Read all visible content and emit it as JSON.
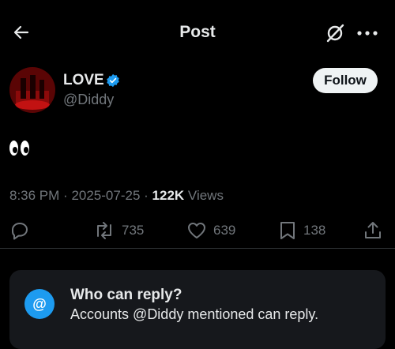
{
  "header": {
    "title": "Post",
    "icons": {
      "back": "arrow-left-icon",
      "grok": "grok-icon",
      "more": "more-dots-icon"
    }
  },
  "author": {
    "name": "LOVE",
    "handle": "@Diddy",
    "verified": true,
    "follow_label": "Follow"
  },
  "post": {
    "text_emoji": "👀",
    "time": "8:36 PM",
    "date": "2025-07-25",
    "views_count": "122K",
    "views_label": "Views"
  },
  "actions": {
    "reply": {
      "icon": "reply-icon",
      "count": ""
    },
    "repost": {
      "icon": "repost-icon",
      "count": "735"
    },
    "like": {
      "icon": "heart-icon",
      "count": "639"
    },
    "bookmark": {
      "icon": "bookmark-icon",
      "count": "138"
    },
    "share": {
      "icon": "share-icon"
    }
  },
  "reply_notice": {
    "title": "Who can reply?",
    "subtitle": "Accounts @Diddy mentioned can reply."
  },
  "colors": {
    "background": "#000000",
    "text": "#e7e9ea",
    "muted": "#71767b",
    "accent": "#1d9bf0",
    "divider": "#2f3336"
  }
}
